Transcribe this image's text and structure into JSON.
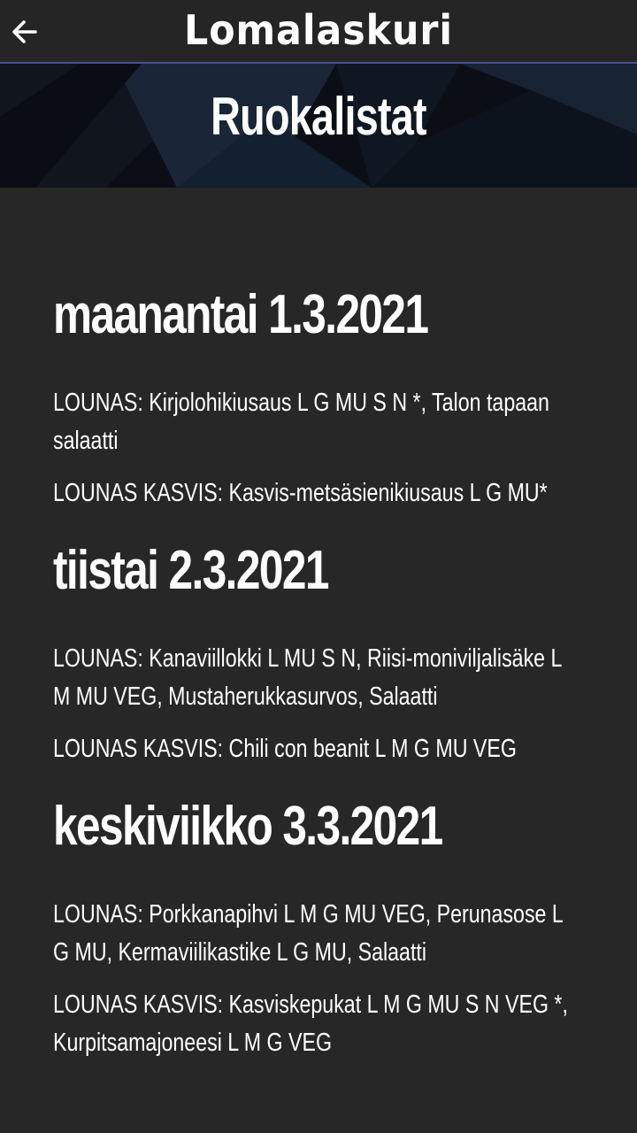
{
  "app_bar": {
    "title": "Lomalaskuri",
    "back_icon": "arrow-left-icon",
    "accent_line_color": "#4a4f8e"
  },
  "hero": {
    "title": "Ruokalistat"
  },
  "days": [
    {
      "heading": "maanantai 1.3.2021",
      "meals": [
        "LOUNAS: Kirjolohikiusaus L G MU S N *, Talon tapaan salaatti",
        "LOUNAS KASVIS: Kasvis-metsäsienikiusaus L G MU*"
      ]
    },
    {
      "heading": "tiistai 2.3.2021",
      "meals": [
        "LOUNAS: Kanaviillokki L MU S N, Riisi-moniviljalisäke L M MU VEG, Mustaherukkasurvos, Salaatti",
        "LOUNAS KASVIS: Chili con beanit L M G MU VEG"
      ]
    },
    {
      "heading": "keskiviikko 3.3.2021",
      "meals": [
        "LOUNAS: Porkkanapihvi L M G MU VEG, Perunasose L G MU, Kermaviilikastike L G MU, Salaatti",
        "LOUNAS KASVIS: Kasviskepukat L M G MU S N VEG *, Kurpitsamajoneesi L M G VEG"
      ]
    }
  ]
}
